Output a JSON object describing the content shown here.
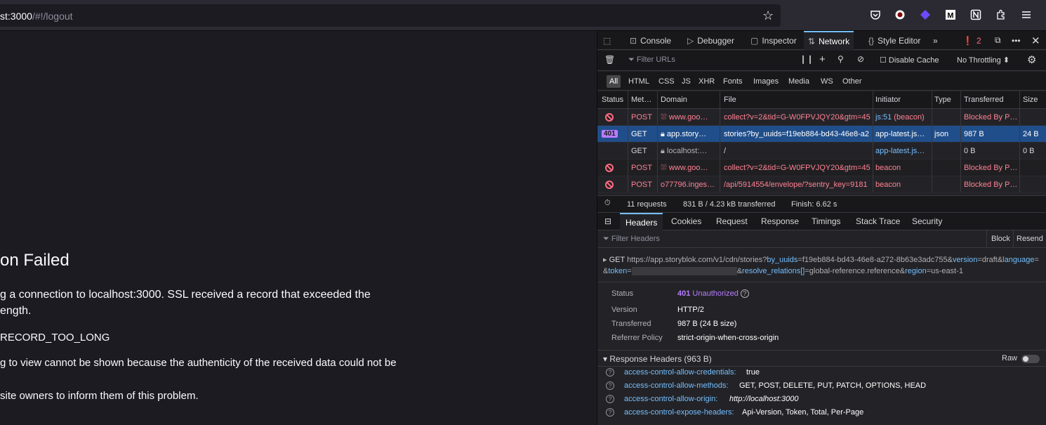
{
  "browser": {
    "url_prefix": "st:3000",
    "url_rest": "/#!/logout"
  },
  "page": {
    "title": "on Failed",
    "line1": "g a connection to localhost:3000. SSL received a record that exceeded the",
    "line2": "ength.",
    "error_code": "RECORD_TOO_LONG",
    "line3": "g to view cannot be shown because the authenticity of the received data could not be",
    "line4": "site owners to inform them of this problem."
  },
  "devtools": {
    "tabs": [
      "Console",
      "Debugger",
      "Inspector",
      "Network",
      "Style Editor"
    ],
    "error_count": "2",
    "filter_placeholder": "Filter URLs",
    "disable_cache": "Disable Cache",
    "throttling": "No Throttling ⬍",
    "type_filters": [
      "All",
      "HTML",
      "CSS",
      "JS",
      "XHR",
      "Fonts",
      "Images",
      "Media",
      "WS",
      "Other"
    ],
    "columns": [
      "Status",
      "Met…",
      "Domain",
      "File",
      "Initiator",
      "Type",
      "Transferred",
      "Size"
    ],
    "requests": [
      {
        "status": "",
        "method": "POST",
        "domain": "www.goo…",
        "file": "collect?v=2&tid=G-W0FPVJQY20&gtm=45",
        "initiator": "js:51 (beacon)",
        "type": "",
        "transferred": "Blocked By P…",
        "size": ""
      },
      {
        "status": "401",
        "method": "GET",
        "domain": "app.story…",
        "file": "stories?by_uuids=f19eb884-bd43-46e8-a2",
        "initiator": "app-latest.js…",
        "type": "json",
        "transferred": "987 B",
        "size": "24 B"
      },
      {
        "status": "",
        "method": "GET",
        "domain": "localhost:…",
        "file": "/",
        "initiator": "app-latest.js…",
        "type": "",
        "transferred": "0 B",
        "size": "0 B"
      },
      {
        "status": "",
        "method": "POST",
        "domain": "www.goo…",
        "file": "collect?v=2&tid=G-W0FPVJQY20&gtm=45",
        "initiator": "beacon",
        "type": "",
        "transferred": "Blocked By P…",
        "size": ""
      },
      {
        "status": "",
        "method": "POST",
        "domain": "o77796.inges…",
        "file": "/api/5914554/envelope/?sentry_key=9181",
        "initiator": "beacon",
        "type": "",
        "transferred": "Blocked By P…",
        "size": ""
      }
    ],
    "summary": {
      "requests": "11 requests",
      "transferred": "831 B / 4.23 kB transferred",
      "finish": "Finish: 6.62 s"
    },
    "detail_tabs": [
      "Headers",
      "Cookies",
      "Request",
      "Response",
      "Timings",
      "Stack Trace",
      "Security"
    ],
    "filter_headers": "Filter Headers",
    "block_label": "Block",
    "resend_label": "Resend",
    "request_line": {
      "method": "GET",
      "base": "https://app.storyblok.com/v1/cdn/stories?",
      "p1": "by_uuids",
      "v1": "=f19eb884-bd43-46e8-a272-8b63e3adc755&",
      "p2": "version",
      "v2": "=draft&l",
      "p3": "anguage",
      "v3": "=&",
      "p4": "token",
      "v4": "=",
      "v5": "&",
      "p5": "resolve_relations[]",
      "v6": "=global-reference.reference&",
      "p6": "region",
      "v7": "=us-east-1"
    },
    "status_info": {
      "status_label": "Status",
      "status_code": "401",
      "status_text": "Unauthorized",
      "version_label": "Version",
      "version": "HTTP/2",
      "transferred_label": "Transferred",
      "transferred": "987 B (24 B size)",
      "referrer_label": "Referrer Policy",
      "referrer": "strict-origin-when-cross-origin"
    },
    "response_headers_title": "Response Headers (963 B)",
    "raw_label": "Raw",
    "response_headers": [
      {
        "name": "access-control-allow-credentials:",
        "value": "true"
      },
      {
        "name": "access-control-allow-methods:",
        "value": "GET, POST, DELETE, PUT, PATCH, OPTIONS, HEAD"
      },
      {
        "name": "access-control-allow-origin:",
        "value": "http://localhost:3000"
      },
      {
        "name": "access-control-expose-headers:",
        "value": "Api-Version, Token, Total, Per-Page"
      }
    ]
  }
}
